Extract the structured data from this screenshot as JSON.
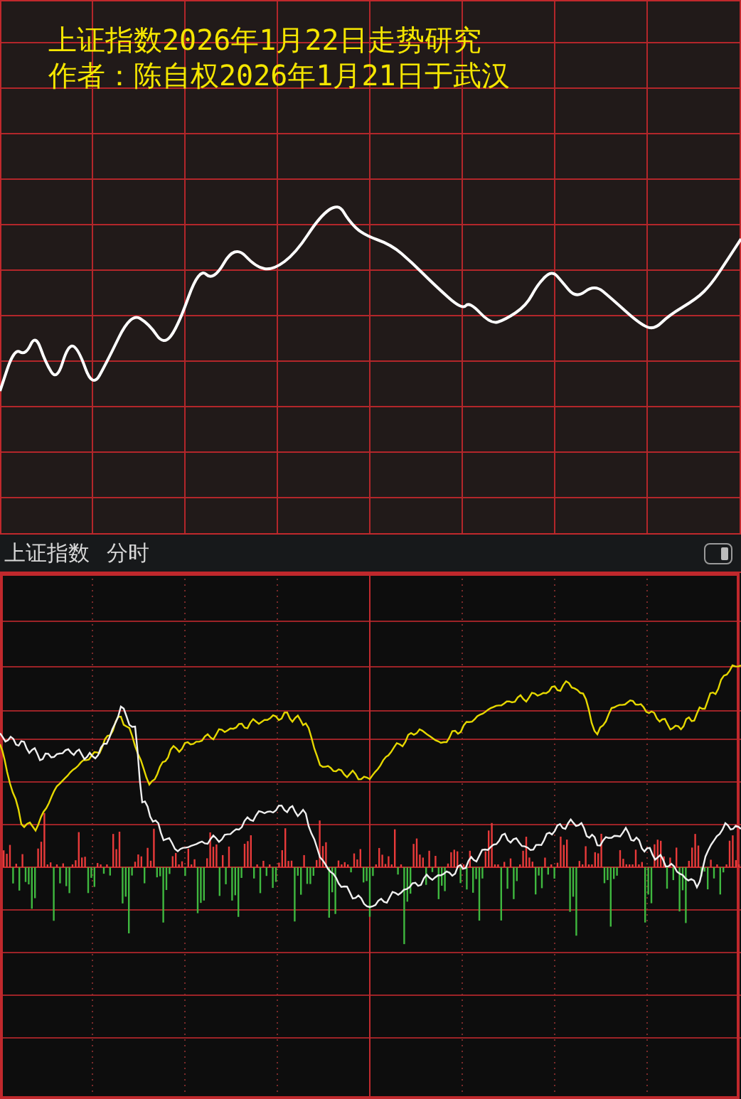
{
  "chart_title": {
    "lines": [
      "上证指数2026年1月22日走势研究",
      "作者：陈自权2026年1月21日于武汉"
    ]
  },
  "quote_header": {
    "name": "上证指数",
    "period": "分时"
  }
}
